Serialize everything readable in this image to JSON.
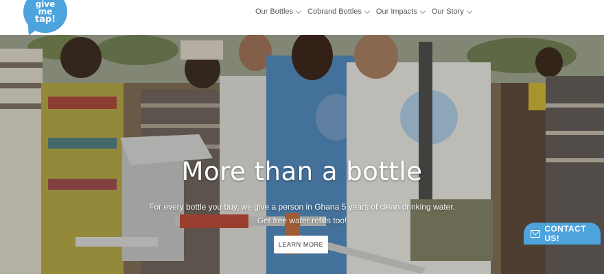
{
  "logo": {
    "line1": "give",
    "line2": "me",
    "line3": "tap!"
  },
  "nav": {
    "items": [
      {
        "label": "Our Bottles"
      },
      {
        "label": "Cobrand Bottles"
      },
      {
        "label": "Our Impacts"
      },
      {
        "label": "Our Story"
      }
    ]
  },
  "hero": {
    "title": "More than a bottle",
    "subtitle_line1": "For every bottle you buy, we give a person in Ghana 5 years of clean drinking water.",
    "subtitle_line2": "Get free water refills too!",
    "cta_label": "LEARN MORE"
  },
  "contact": {
    "label": "CONTACT US!",
    "icon": "envelope-icon"
  },
  "colors": {
    "brand_blue": "#4da3dc",
    "header_bg": "#ffffff",
    "hero_text": "#ffffff"
  }
}
